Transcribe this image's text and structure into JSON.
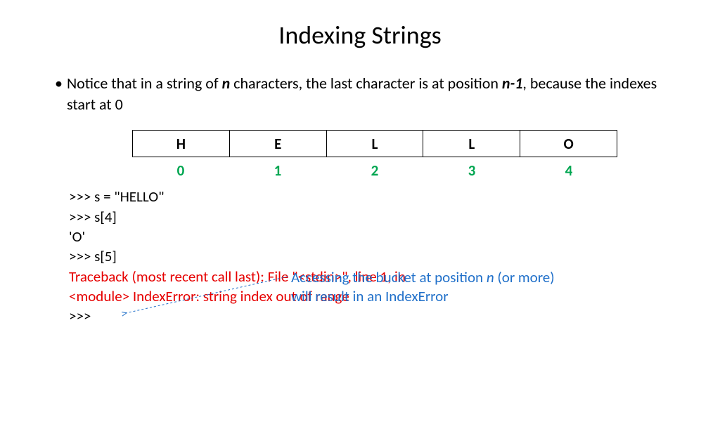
{
  "title": "Indexing Strings",
  "bullet": {
    "pre": "Notice that in a string of ",
    "n": "n",
    "mid": " characters, the last character is at position ",
    "nminus": "n",
    "minus": "-1",
    "post": ", because the indexes start at 0"
  },
  "table": {
    "cells": [
      "H",
      "E",
      "L",
      "L",
      "O"
    ],
    "indexes": [
      "0",
      "1",
      "2",
      "3",
      "4"
    ]
  },
  "code": {
    "l1": ">>> s = \"HELLO\"",
    "l2": ">>> s[4]",
    "l3": "'O'",
    "l4": ">>> s[5]",
    "err1": "Traceback (most recent call last): File \"<stdin>\", line 1, in",
    "err2": "<module> IndexError: string index out of range",
    "l5": ">>>"
  },
  "callout": {
    "pre": "Accessing the bucket at position ",
    "n": "n",
    "rest1": " (or more)",
    "line2": "will result in an IndexError"
  }
}
